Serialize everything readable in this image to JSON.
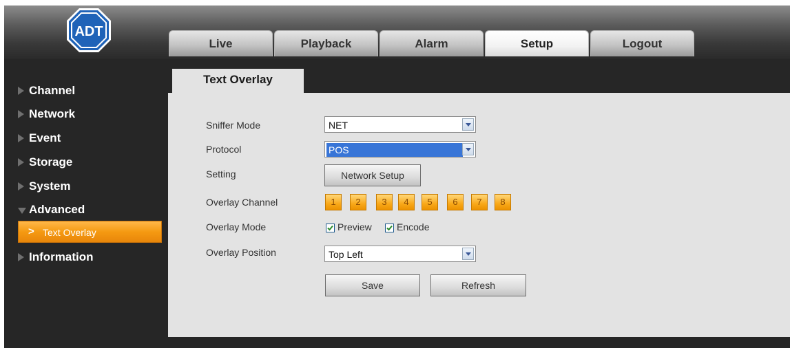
{
  "header": {
    "logo_text": "ADT",
    "tabs": [
      {
        "label": "Live"
      },
      {
        "label": "Playback"
      },
      {
        "label": "Alarm"
      },
      {
        "label": "Setup",
        "active": true
      },
      {
        "label": "Logout"
      }
    ]
  },
  "sidebar": {
    "items": [
      {
        "label": "Channel"
      },
      {
        "label": "Network"
      },
      {
        "label": "Event"
      },
      {
        "label": "Storage"
      },
      {
        "label": "System"
      },
      {
        "label": "Advanced",
        "expanded": true
      },
      {
        "label": "Information"
      }
    ],
    "subitem": {
      "label": "Text Overlay"
    }
  },
  "main": {
    "tab_title": "Text Overlay",
    "fields": {
      "sniffer_mode_label": "Sniffer Mode",
      "sniffer_mode_value": "NET",
      "protocol_label": "Protocol",
      "protocol_value": "POS",
      "setting_label": "Setting",
      "network_setup_button": "Network Setup",
      "overlay_channel_label": "Overlay Channel",
      "channels": [
        "1",
        "2",
        "3",
        "4",
        "5",
        "6",
        "7",
        "8"
      ],
      "overlay_mode_label": "Overlay Mode",
      "preview_label": "Preview",
      "preview_checked": true,
      "encode_label": "Encode",
      "encode_checked": true,
      "overlay_position_label": "Overlay Position",
      "overlay_position_value": "Top Left"
    },
    "buttons": {
      "save": "Save",
      "refresh": "Refresh"
    }
  },
  "colors": {
    "accent_orange": "#f59a12",
    "background_dark": "#262626",
    "panel_gray": "#e3e3e3",
    "selection_blue": "#3875d7"
  }
}
